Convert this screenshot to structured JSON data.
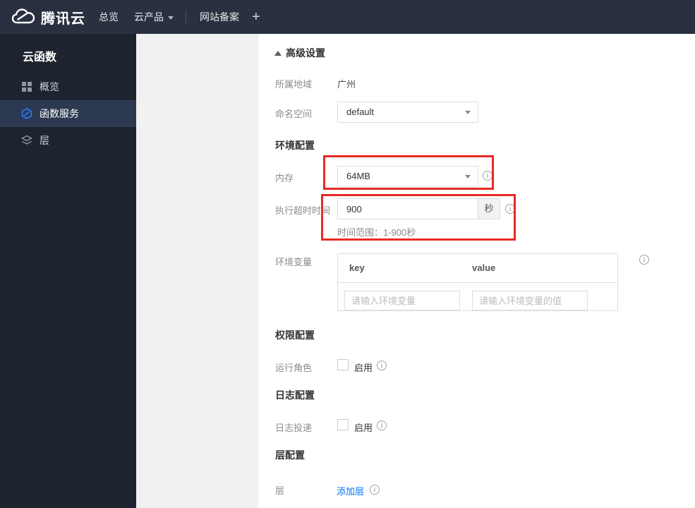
{
  "topbar": {
    "brand": "腾讯云",
    "nav_overview": "总览",
    "nav_products": "云产品",
    "nav_icp": "网站备案",
    "nav_plus": "+"
  },
  "sidebar": {
    "title": "云函数",
    "items": [
      {
        "label": "概览",
        "icon": "grid-icon"
      },
      {
        "label": "函数服务",
        "icon": "scf-hexagon-icon"
      },
      {
        "label": "层",
        "icon": "layers-icon"
      }
    ]
  },
  "form": {
    "advanced_toggle": "高级设置",
    "region": {
      "label": "所属地域",
      "value": "广州"
    },
    "namespace": {
      "label": "命名空间",
      "value": "default"
    },
    "env_section": "环境配置",
    "memory": {
      "label": "内存",
      "value": "64MB"
    },
    "timeout": {
      "label": "执行超时时间",
      "value": "900",
      "unit": "秒",
      "hint": "时间范围：1-900秒"
    },
    "env_vars": {
      "label": "环境变量",
      "key_header": "key",
      "value_header": "value",
      "key_placeholder": "请输入环境变量",
      "value_placeholder": "请输入环境变量的值"
    },
    "perm_section": "权限配置",
    "role": {
      "label": "运行角色",
      "checkbox_label": "启用"
    },
    "log_section": "日志配置",
    "log": {
      "label": "日志投递",
      "checkbox_label": "启用"
    },
    "layer_section": "层配置",
    "layer": {
      "label": "层",
      "add_link": "添加层"
    }
  },
  "colors": {
    "annotation_red": "#e62b23",
    "link_blue": "#006eff",
    "topbar_bg": "#29303f",
    "sidebar_bg": "#1e242f"
  }
}
